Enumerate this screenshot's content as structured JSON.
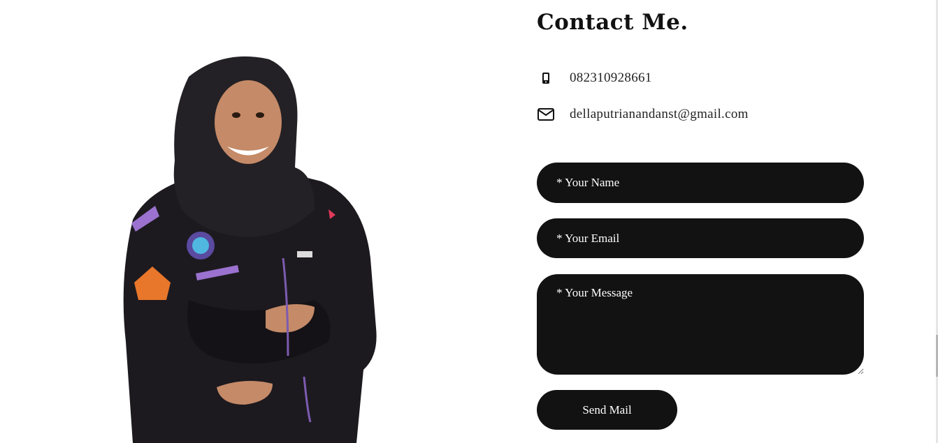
{
  "contact": {
    "heading": "Contact Me.",
    "phone": {
      "icon": "smartphone-icon",
      "value": "082310928661"
    },
    "email": {
      "icon": "envelope-icon",
      "value": "dellaputrianandanst@gmail.com"
    }
  },
  "form": {
    "name_placeholder": "* Your Name",
    "email_placeholder": "* Your Email",
    "message_placeholder": "* Your Message",
    "name_value": "",
    "email_value": "",
    "message_value": "",
    "submit_label": "Send Mail"
  },
  "colors": {
    "field_background": "#121212",
    "field_text": "#ffffff",
    "page_background": "#ffffff",
    "heading": "#111111"
  }
}
